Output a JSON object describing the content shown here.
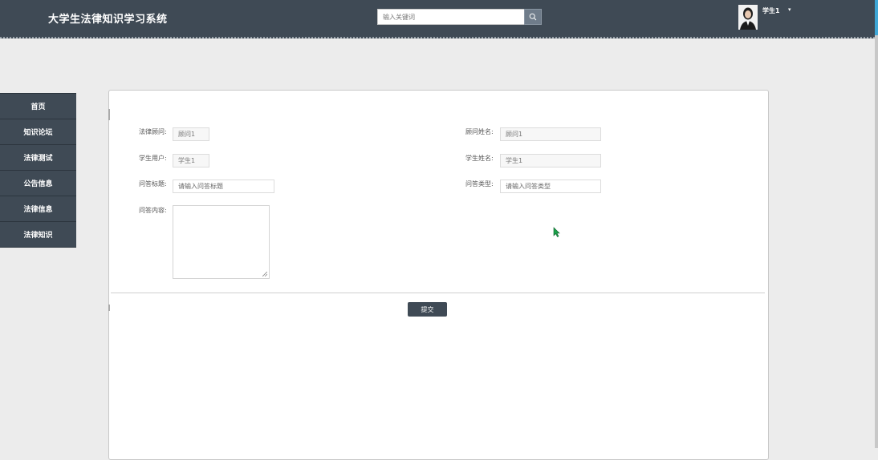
{
  "header": {
    "site_title": "大学生法律知识学习系统",
    "search_placeholder": "输入关键词",
    "username": "学生1",
    "caret": "▾"
  },
  "sidebar": {
    "items": [
      {
        "label": "首页"
      },
      {
        "label": "知识论坛"
      },
      {
        "label": "法律测试"
      },
      {
        "label": "公告信息"
      },
      {
        "label": "法律信息"
      },
      {
        "label": "法律知识"
      }
    ]
  },
  "form": {
    "advisor_label": "法律顾问:",
    "advisor_value": "顾问1",
    "advisor_name_label": "顾问姓名:",
    "advisor_name_value": "顾问1",
    "student_user_label": "学生用户:",
    "student_user_value": "学生1",
    "student_name_label": "学生姓名:",
    "student_name_value": "学生1",
    "title_label": "问答标题:",
    "title_placeholder": "请输入问答标题",
    "type_label": "问答类型:",
    "type_placeholder": "请输入问答类型",
    "content_label": "问答内容:",
    "submit_label": "提交"
  },
  "colors": {
    "header_bg": "#3f4a55",
    "page_bg": "#ececec",
    "accent_scroll": "#3fa7d6"
  }
}
